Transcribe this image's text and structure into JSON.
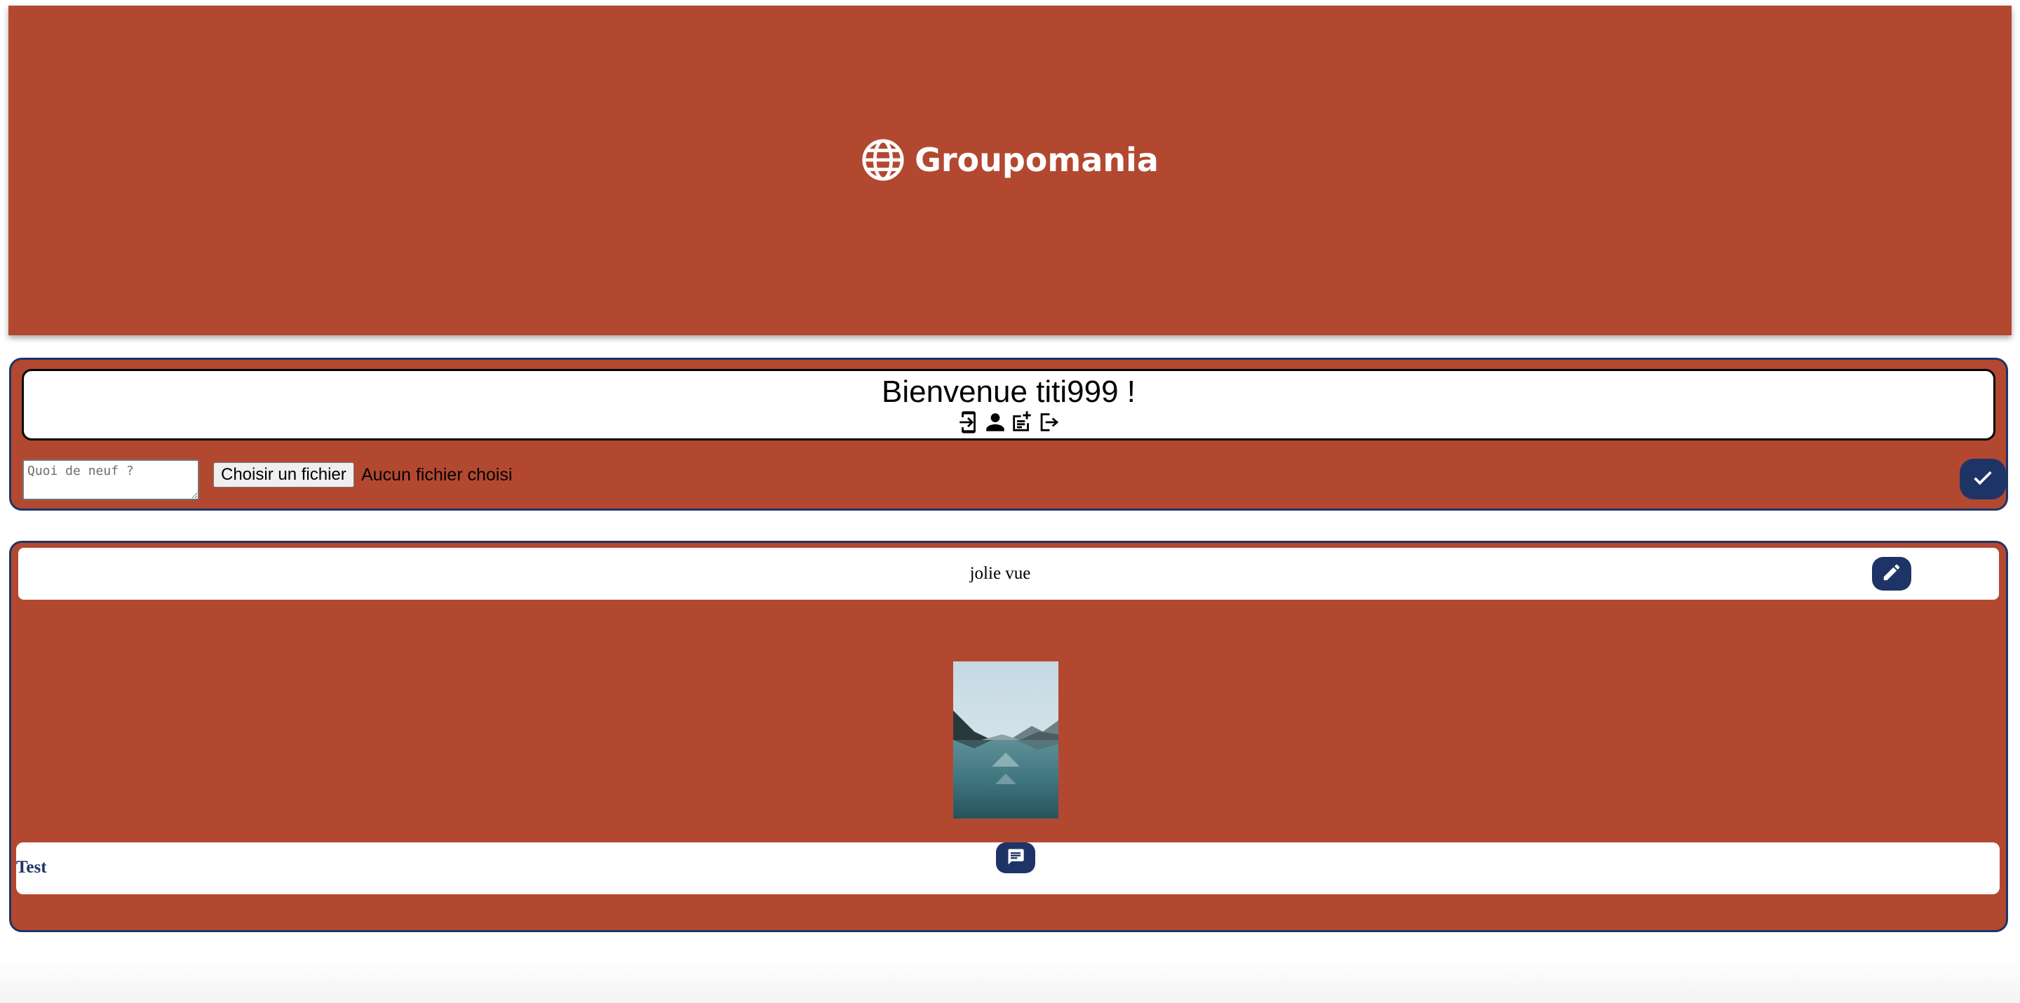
{
  "header": {
    "brand": "Groupomania",
    "logo_icon": "globe-icon",
    "background": "#b34830"
  },
  "composer": {
    "welcome": "Bienvenue titi999 !",
    "nav_icons": [
      "phone-link-icon",
      "user-icon",
      "new-post-icon",
      "logout-icon"
    ],
    "input_placeholder": "Quoi de neuf ?",
    "file_button_label": "Choisir un fichier",
    "file_status": "Aucun fichier choisi",
    "submit_icon": "check-icon"
  },
  "post": {
    "text": "jolie vue",
    "edit_icon": "pencil-icon",
    "image_alt": "mountain lake landscape",
    "comment_author": "Test",
    "comment_icon": "comment-icon"
  },
  "colors": {
    "accent_red": "#b34830",
    "navy": "#1f3466"
  }
}
